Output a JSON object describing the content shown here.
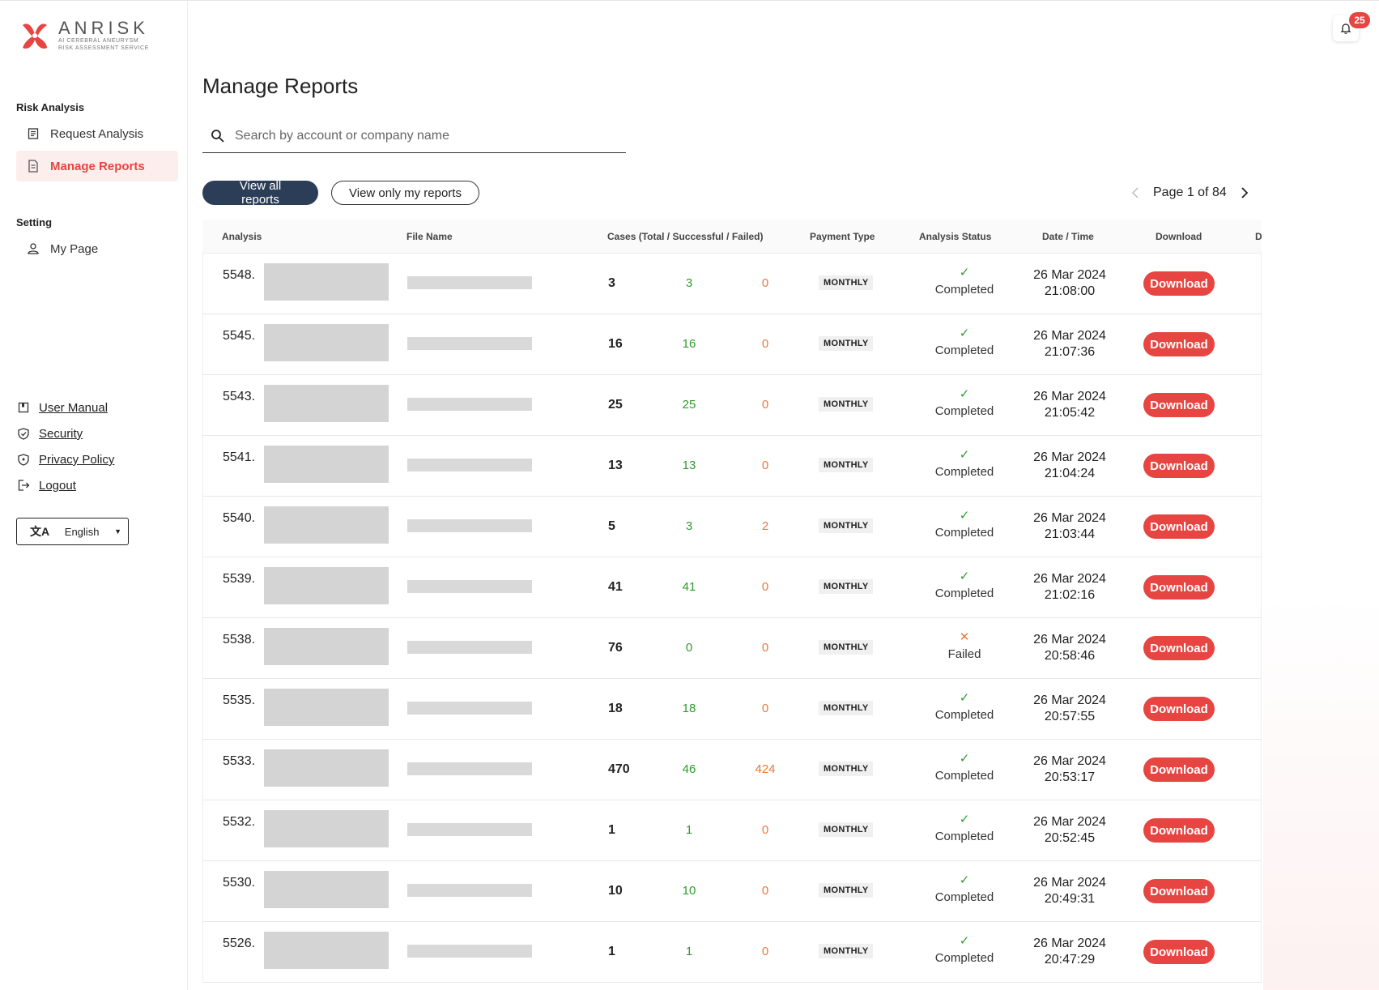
{
  "brand": {
    "name": "ANRISK",
    "subtitle_line1": "AI CEREBRAL ANEURYSM",
    "subtitle_line2": "RISK ASSESSMENT SERVICE",
    "accent": "#e64541",
    "navy": "#2c3e57"
  },
  "sidebar": {
    "section1_title": "Risk Analysis",
    "items": [
      {
        "label": "Request Analysis",
        "icon": "document-list-icon"
      },
      {
        "label": "Manage Reports",
        "icon": "report-icon",
        "active": true
      }
    ],
    "section2_title": "Setting",
    "setting_items": [
      {
        "label": "My Page",
        "icon": "user-icon"
      }
    ],
    "links": [
      {
        "label": "User Manual",
        "icon": "book-icon"
      },
      {
        "label": "Security",
        "icon": "shield-check-icon"
      },
      {
        "label": "Privacy Policy",
        "icon": "shield-icon"
      },
      {
        "label": "Logout",
        "icon": "logout-icon"
      }
    ],
    "language": "English"
  },
  "header": {
    "notification_count": "25"
  },
  "main": {
    "title": "Manage Reports",
    "search_placeholder": "Search by account or company name",
    "filter_all": "View all reports",
    "filter_mine": "View only my reports",
    "page_label": "Page 1 of 84"
  },
  "table": {
    "columns": [
      "Analysis",
      "File Name",
      "Cases (Total / Successful / Failed)",
      "Payment Type",
      "Analysis Status",
      "Date / Time",
      "Download",
      "D"
    ],
    "download_label": "Download",
    "rows": [
      {
        "id": "5548.",
        "total": "3",
        "success": "3",
        "failed": "0",
        "payment": "MONTHLY",
        "status": "Completed",
        "ok": true,
        "date": "26 Mar 2024",
        "time": "21:08:00"
      },
      {
        "id": "5545.",
        "total": "16",
        "success": "16",
        "failed": "0",
        "payment": "MONTHLY",
        "status": "Completed",
        "ok": true,
        "date": "26 Mar 2024",
        "time": "21:07:36"
      },
      {
        "id": "5543.",
        "total": "25",
        "success": "25",
        "failed": "0",
        "payment": "MONTHLY",
        "status": "Completed",
        "ok": true,
        "date": "26 Mar 2024",
        "time": "21:05:42"
      },
      {
        "id": "5541.",
        "total": "13",
        "success": "13",
        "failed": "0",
        "payment": "MONTHLY",
        "status": "Completed",
        "ok": true,
        "date": "26 Mar 2024",
        "time": "21:04:24"
      },
      {
        "id": "5540.",
        "total": "5",
        "success": "3",
        "failed": "2",
        "payment": "MONTHLY",
        "status": "Completed",
        "ok": true,
        "date": "26 Mar 2024",
        "time": "21:03:44"
      },
      {
        "id": "5539.",
        "total": "41",
        "success": "41",
        "failed": "0",
        "payment": "MONTHLY",
        "status": "Completed",
        "ok": true,
        "date": "26 Mar 2024",
        "time": "21:02:16"
      },
      {
        "id": "5538.",
        "total": "76",
        "success": "0",
        "failed": "0",
        "payment": "MONTHLY",
        "status": "Failed",
        "ok": false,
        "date": "26 Mar 2024",
        "time": "20:58:46"
      },
      {
        "id": "5535.",
        "total": "18",
        "success": "18",
        "failed": "0",
        "payment": "MONTHLY",
        "status": "Completed",
        "ok": true,
        "date": "26 Mar 2024",
        "time": "20:57:55"
      },
      {
        "id": "5533.",
        "total": "470",
        "success": "46",
        "failed": "424",
        "payment": "MONTHLY",
        "status": "Completed",
        "ok": true,
        "date": "26 Mar 2024",
        "time": "20:53:17"
      },
      {
        "id": "5532.",
        "total": "1",
        "success": "1",
        "failed": "0",
        "payment": "MONTHLY",
        "status": "Completed",
        "ok": true,
        "date": "26 Mar 2024",
        "time": "20:52:45"
      },
      {
        "id": "5530.",
        "total": "10",
        "success": "10",
        "failed": "0",
        "payment": "MONTHLY",
        "status": "Completed",
        "ok": true,
        "date": "26 Mar 2024",
        "time": "20:49:31"
      },
      {
        "id": "5526.",
        "total": "1",
        "success": "1",
        "failed": "0",
        "payment": "MONTHLY",
        "status": "Completed",
        "ok": true,
        "date": "26 Mar 2024",
        "time": "20:47:29"
      }
    ]
  }
}
